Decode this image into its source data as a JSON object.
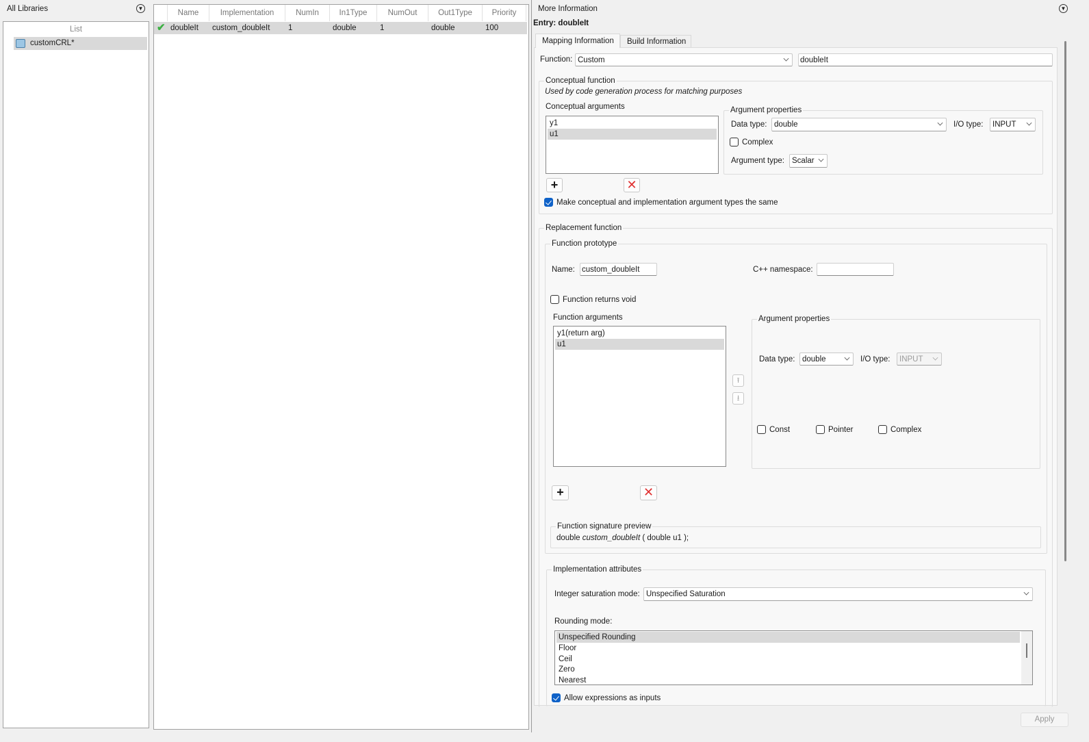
{
  "left": {
    "title": "All Libraries",
    "list_header": "List",
    "items": [
      {
        "label": "customCRL*"
      }
    ]
  },
  "table": {
    "columns": [
      "Name",
      "Implementation",
      "NumIn",
      "In1Type",
      "NumOut",
      "Out1Type",
      "Priority"
    ],
    "rows": [
      {
        "status": "valid",
        "cells": [
          "doubleIt",
          "custom_doubleIt",
          "1",
          "double",
          "1",
          "double",
          "100"
        ]
      }
    ]
  },
  "right": {
    "title": "More Information",
    "entry": "Entry: doubleIt",
    "tabs": [
      {
        "label": "Mapping Information",
        "active": true
      },
      {
        "label": "Build Information",
        "active": false
      }
    ],
    "function_label": "Function:",
    "function_value": "Custom",
    "function_name": "doubleIt",
    "conceptual": {
      "title": "Conceptual function",
      "note": "Used by code generation process for matching purposes",
      "args_label": "Conceptual arguments",
      "args": [
        "y1",
        "u1"
      ],
      "selected": 1,
      "props": {
        "title": "Argument properties",
        "data_type_label": "Data type:",
        "data_type": "double",
        "io_type_label": "I/O type:",
        "io_type": "INPUT",
        "complex_label": "Complex",
        "complex": false,
        "arg_type_label": "Argument type:",
        "arg_type": "Scalar"
      },
      "same_types_label": "Make conceptual and implementation argument types the same",
      "same_types": true
    },
    "replacement": {
      "title": "Replacement function",
      "prototype_title": "Function prototype",
      "name_label": "Name:",
      "name": "custom_doubleIt",
      "ns_label": "C++ namespace:",
      "ns": "",
      "void_label": "Function returns void",
      "void": false,
      "args_label": "Function arguments",
      "args": [
        "y1(return arg)",
        "u1"
      ],
      "selected": 1,
      "props": {
        "title": "Argument properties",
        "data_type_label": "Data type:",
        "data_type": "double",
        "io_type_label": "I/O type:",
        "io_type": "INPUT",
        "const_label": "Const",
        "pointer_label": "Pointer",
        "complex_label": "Complex"
      },
      "sig_title": "Function signature preview",
      "sig_pre": "double",
      "sig_name": "custom_doubleIt",
      "sig_post": "( double u1 );"
    },
    "impl": {
      "title": "Implementation attributes",
      "sat_label": "Integer saturation mode:",
      "sat": "Unspecified Saturation",
      "round_label": "Rounding mode:",
      "round_options": [
        "Unspecified Rounding",
        "Floor",
        "Ceil",
        "Zero",
        "Nearest"
      ],
      "round_selected": 0,
      "expr_label": "Allow expressions as inputs",
      "expr": true
    },
    "apply": "Apply"
  },
  "colors": {
    "accent": "#0f62c8",
    "delete": "#e03030",
    "valid": "#3cb043"
  }
}
